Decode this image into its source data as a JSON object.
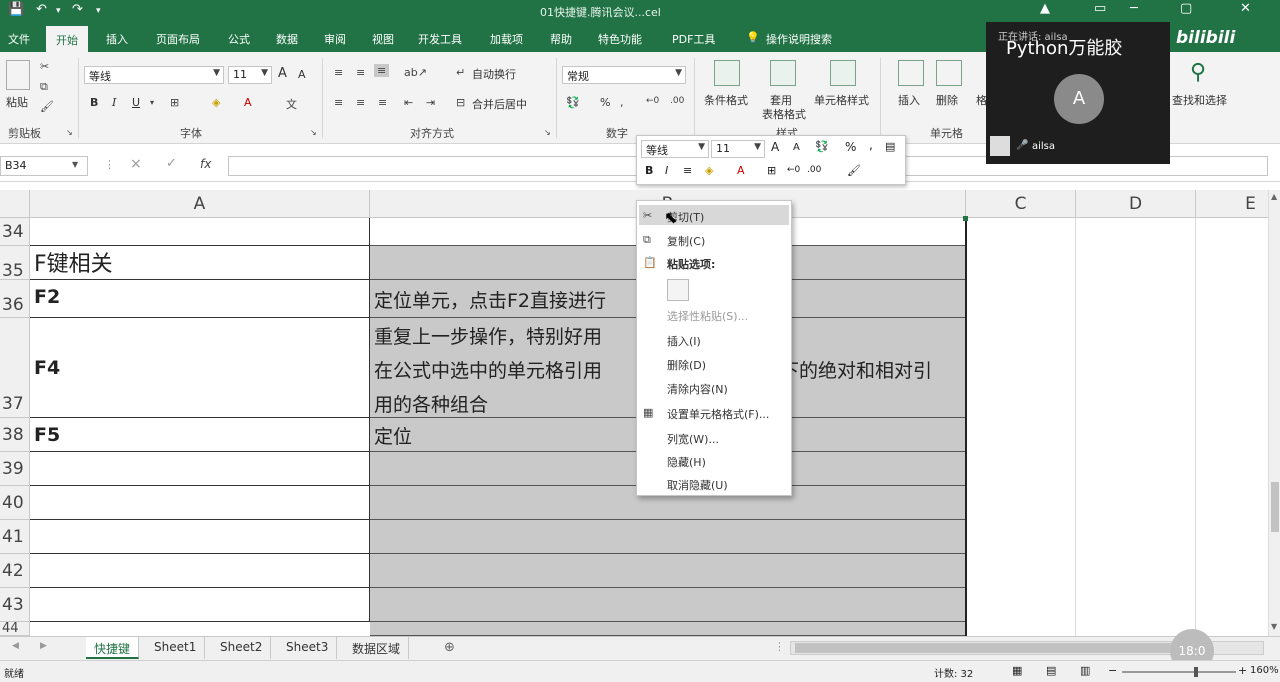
{
  "titlebar": {
    "title": "01快捷键.腾讯会议...cel",
    "save_icon": "save-icon",
    "undo_icon": "undo-icon",
    "brand_color": "#217346"
  },
  "menu": {
    "tabs": [
      "文件",
      "开始",
      "插入",
      "页面布局",
      "公式",
      "数据",
      "审阅",
      "视图",
      "开发工具",
      "加载项",
      "帮助",
      "特色功能",
      "PDF工具",
      "操作说明搜索"
    ],
    "active": "开始"
  },
  "ribbon": {
    "clipboard": {
      "paste": "粘贴",
      "label": "剪贴板"
    },
    "font": {
      "name": "等线",
      "size": "11",
      "grow": "A",
      "shrink": "A",
      "bold": "B",
      "italic": "I",
      "underline": "U",
      "label": "字体"
    },
    "alignment": {
      "wrap": "自动换行",
      "merge": "合并后居中",
      "label": "对齐方式"
    },
    "number": {
      "format": "常规",
      "percent": "%",
      "label": "数字"
    },
    "styles": {
      "cond": "条件格式",
      "table_a": "套用",
      "table_b": "表格格式",
      "cell": "单元格样式",
      "label": "样式"
    },
    "cells": {
      "insert": "插入",
      "delete": "删除",
      "format": "格",
      "label": "单元格"
    },
    "editing": {
      "find": "查找和选择"
    }
  },
  "formula_bar": {
    "name_box": "B34",
    "cancel": "×",
    "enter": "✓",
    "fx": "fx",
    "value": ""
  },
  "columns": [
    "A",
    "B",
    "C",
    "D",
    "E"
  ],
  "rows": [
    {
      "num": "34",
      "a": ""
    },
    {
      "num": "35",
      "a": "F键相关"
    },
    {
      "num": "36",
      "a": "F2",
      "b": "定位单元，点击F2直接进行"
    },
    {
      "num": "37",
      "a": "F4",
      "b1": "重复上一步操作，特别好用",
      "b2": "在公式中选中的单元格引用",
      "b2r": "下的绝对和相对引",
      "b3": "用的各种组合"
    },
    {
      "num": "38",
      "a": "F5",
      "b": "定位"
    },
    {
      "num": "39"
    },
    {
      "num": "40"
    },
    {
      "num": "41"
    },
    {
      "num": "42"
    },
    {
      "num": "43"
    },
    {
      "num": "44"
    }
  ],
  "mini_toolbar": {
    "font": "等线",
    "size": "11",
    "grow": "A",
    "shrink": "A",
    "percent": "%",
    "comma": ",",
    "bold": "B",
    "italic": "I"
  },
  "context_menu": {
    "cut": "剪切(T)",
    "copy": "复制(C)",
    "paste_options": "粘贴选项:",
    "paste_special": "选择性粘贴(S)...",
    "insert": "插入(I)",
    "delete": "删除(D)",
    "clear": "清除内容(N)",
    "format_cells": "设置单元格格式(F)...",
    "col_width": "列宽(W)...",
    "hide": "隐藏(H)",
    "unhide": "取消隐藏(U)"
  },
  "video": {
    "name_overlay": "Python万能胶",
    "avatar_letter": "A",
    "user": "ailsa",
    "watermark": "bilibili",
    "small_title": "正在讲话: ailsa"
  },
  "sheet_tabs": [
    "快捷键",
    "Sheet1",
    "Sheet2",
    "Sheet3",
    "数据区域"
  ],
  "active_sheet": "快捷键",
  "status": {
    "mode": "就绪",
    "count": "计数: 32",
    "zoom": "160%",
    "timer": "18:0"
  }
}
